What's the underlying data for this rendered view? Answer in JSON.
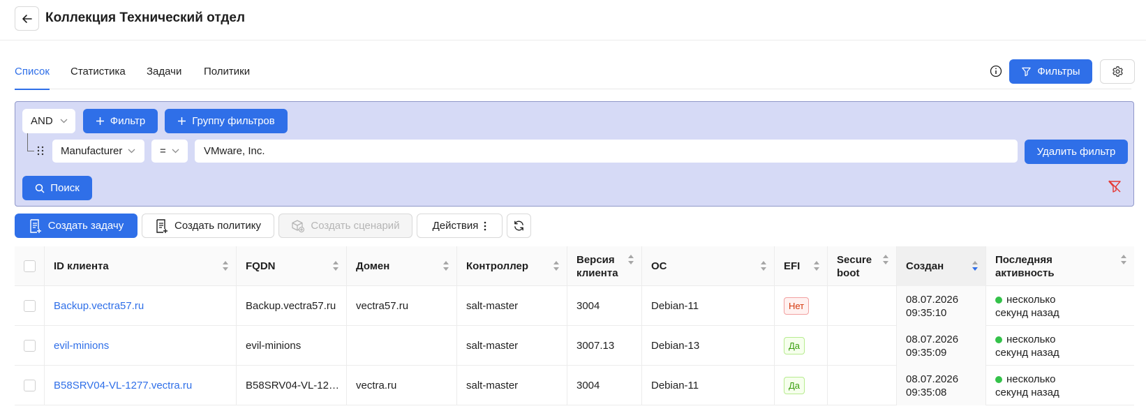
{
  "header": {
    "title": "Коллекция Технический отдел"
  },
  "tabs": [
    {
      "label": "Список"
    },
    {
      "label": "Статистика"
    },
    {
      "label": "Задачи"
    },
    {
      "label": "Политики"
    }
  ],
  "top_actions": {
    "filters_label": "Фильтры"
  },
  "filter_panel": {
    "logic": "AND",
    "add_filter_label": "Фильтр",
    "add_group_label": "Группу фильтров",
    "field": "Manufacturer",
    "operator": "=",
    "value": "VMware, Inc.",
    "remove_filter_label": "Удалить фильтр",
    "search_label": "Поиск"
  },
  "toolbar": {
    "create_task": "Создать задачу",
    "create_policy": "Создать политику",
    "create_scenario": "Создать сценарий",
    "actions": "Действия"
  },
  "table": {
    "columns": [
      "ID клиента",
      "FQDN",
      "Домен",
      "Контроллер",
      "Версия клиента",
      "ОС",
      "EFI",
      "Secure boot",
      "Создан",
      "Последняя активность"
    ],
    "column_lines": {
      "version": [
        "Версия",
        "клиента"
      ],
      "secure": [
        "Secure",
        "boot"
      ],
      "activity": [
        "Последняя",
        "активность"
      ]
    },
    "rows": [
      {
        "id": "Backup.vectra57.ru",
        "fqdn": "Backup.vectra57.ru",
        "domain": "vectra57.ru",
        "controller": "salt-master",
        "version": "3004",
        "os": "Debian-11",
        "efi": "Нет",
        "secure_boot": "",
        "created_date": "08.07.2026",
        "created_time": "09:35:10",
        "activity_1": "несколько",
        "activity_2": "секунд назад"
      },
      {
        "id": "evil-minions",
        "fqdn": "evil-minions",
        "domain": "",
        "controller": "salt-master",
        "version": "3007.13",
        "os": "Debian-13",
        "efi": "Да",
        "secure_boot": "",
        "created_date": "08.07.2026",
        "created_time": "09:35:09",
        "activity_1": "несколько",
        "activity_2": "секунд назад"
      },
      {
        "id": "B58SRV04-VL-1277.vectra.ru",
        "fqdn": "B58SRV04-VL-12…",
        "domain": "vectra.ru",
        "controller": "salt-master",
        "version": "3004",
        "os": "Debian-11",
        "efi": "Да",
        "secure_boot": "",
        "created_date": "08.07.2026",
        "created_time": "09:35:08",
        "activity_1": "несколько",
        "activity_2": "секунд назад"
      }
    ]
  },
  "colors": {
    "primary": "#2f6fe8",
    "panel_bg": "#d6daf6",
    "online": "#34c24a",
    "no_tag": "#d4380d",
    "yes_tag": "#389e0d"
  }
}
